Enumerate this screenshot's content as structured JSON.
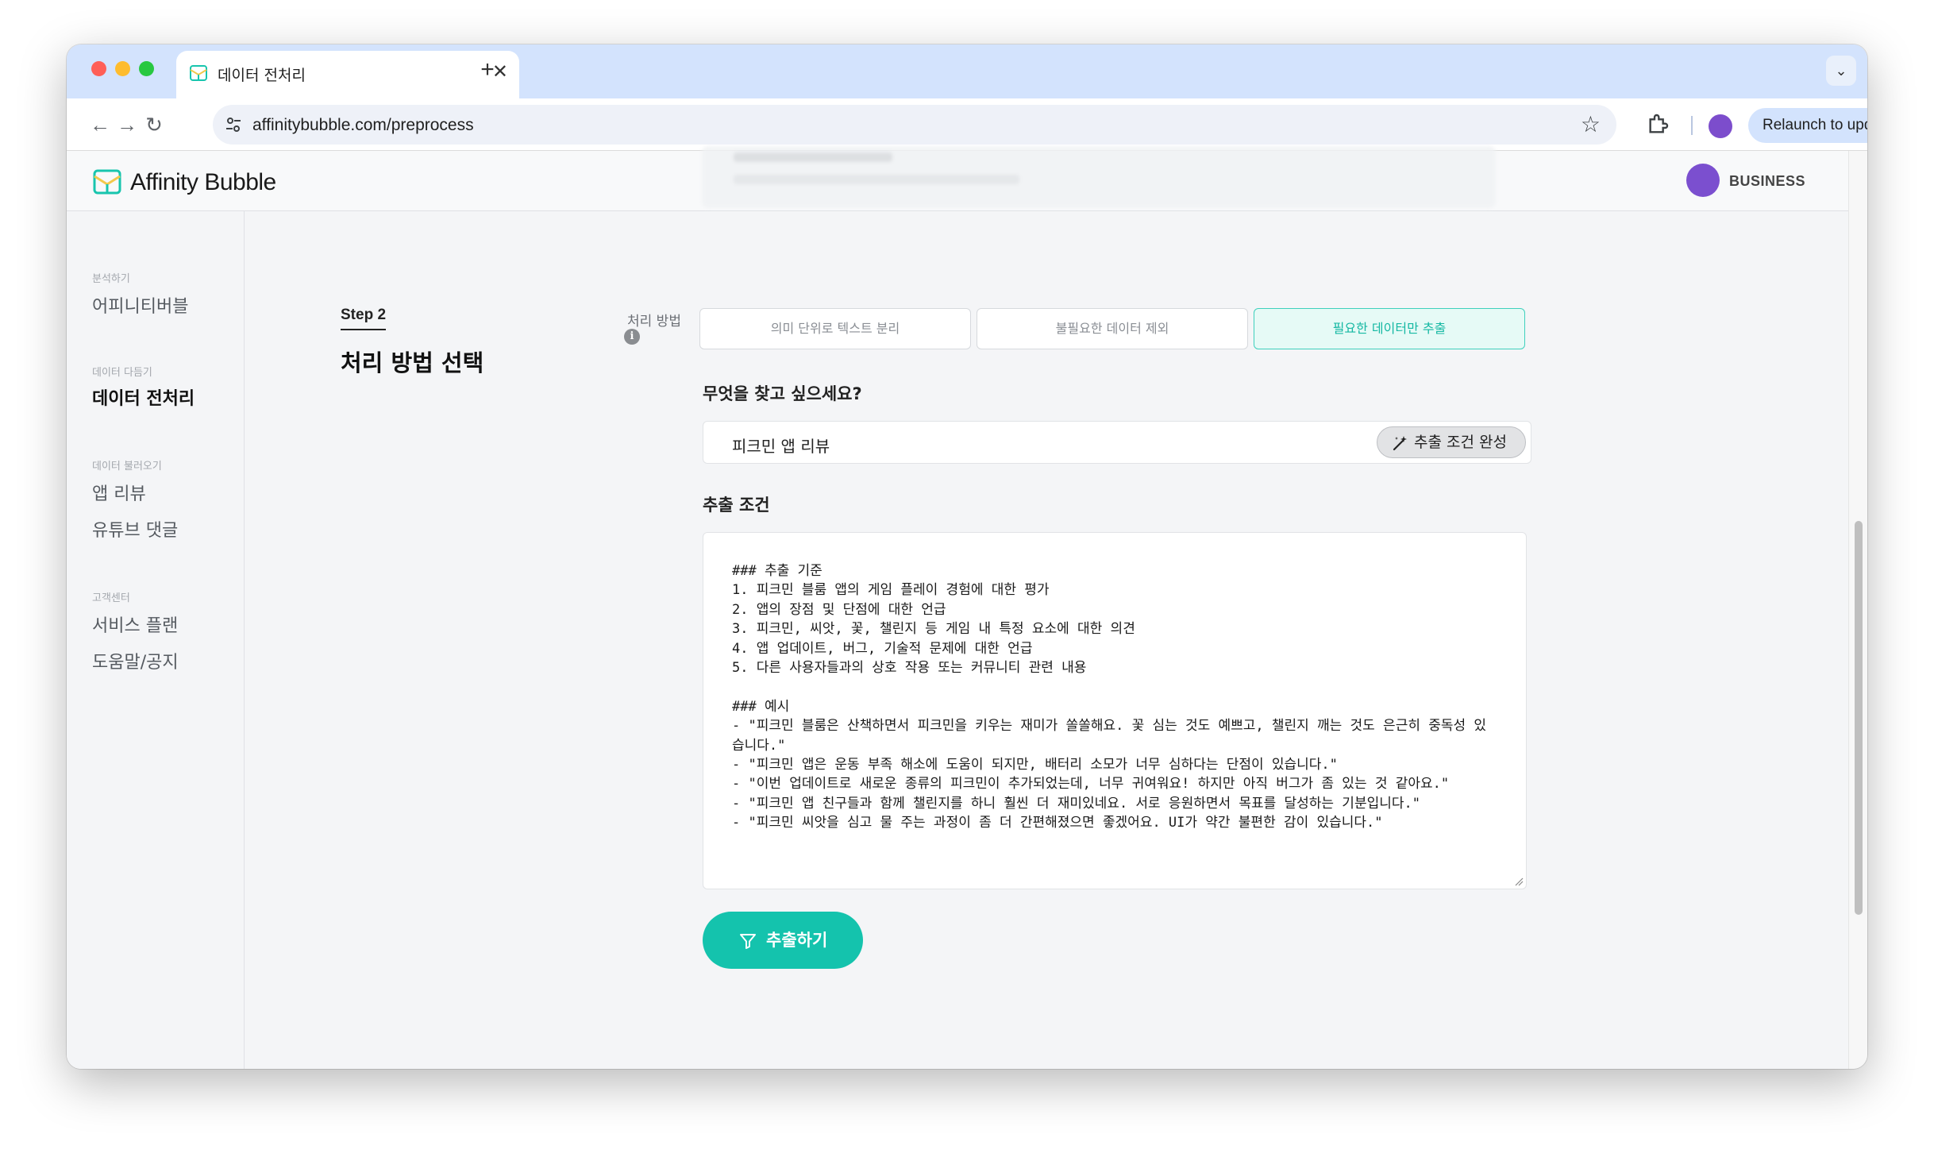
{
  "browser": {
    "tab_title": "데이터 전처리",
    "tab_close": "✕",
    "new_tab": "+",
    "url": "affinitybubble.com/preprocess",
    "relaunch_label": "Relaunch to update",
    "relaunch_more": "⋮"
  },
  "header": {
    "brand_name": "Affinity Bubble",
    "plan_label": "BUSINESS"
  },
  "sidebar": {
    "sections": [
      {
        "category": "분석하기",
        "items": [
          "어피니티버블"
        ]
      },
      {
        "category": "데이터 다듬기",
        "items": [
          "데이터 전처리"
        ]
      },
      {
        "category": "데이터 불러오기",
        "items": [
          "앱 리뷰",
          "유튜브 댓글"
        ]
      },
      {
        "category": "고객센터",
        "items": [
          "서비스 플랜",
          "도움말/공지"
        ]
      }
    ],
    "active_item": "데이터 전처리"
  },
  "main": {
    "step_label": "Step 2",
    "step_title": "처리 방법 선택",
    "method_label": "처리 방법",
    "info_glyph": "i",
    "methods": [
      "의미 단위로 텍스트 분리",
      "불필요한 데이터 제외",
      "필요한 데이터만 추출"
    ],
    "selected_method": "필요한 데이터만 추출",
    "question_label": "무엇을 찾고 싶으세요?",
    "query_value": "피크민 앱 리뷰",
    "complete_button": "추출 조건 완성",
    "conditions_label": "추출 조건",
    "conditions_text": "### 추출 기준\n1. 피크민 블룸 앱의 게임 플레이 경험에 대한 평가\n2. 앱의 장점 및 단점에 대한 언급\n3. 피크민, 씨앗, 꽃, 챌린지 등 게임 내 특정 요소에 대한 의견\n4. 앱 업데이트, 버그, 기술적 문제에 대한 언급\n5. 다른 사용자들과의 상호 작용 또는 커뮤니티 관련 내용\n\n### 예시\n- \"피크민 블룸은 산책하면서 피크민을 키우는 재미가 쏠쏠해요. 꽃 심는 것도 예쁘고, 챌린지 깨는 것도 은근히 중독성 있습니다.\"\n- \"피크민 앱은 운동 부족 해소에 도움이 되지만, 배터리 소모가 너무 심하다는 단점이 있습니다.\"\n- \"이번 업데이트로 새로운 종류의 피크민이 추가되었는데, 너무 귀여워요! 하지만 아직 버그가 좀 있는 것 같아요.\"\n- \"피크민 앱 친구들과 함께 챌린지를 하니 훨씬 더 재미있네요. 서로 응원하면서 목표를 달성하는 기분입니다.\"\n- \"피크민 씨앗을 심고 물 주는 과정이 좀 더 간편해졌으면 좋겠어요. UI가 약간 불편한 감이 있습니다.\"",
    "extract_button": "추출하기"
  },
  "colors": {
    "accent": "#14c3ad",
    "selected_bg": "#e6faf6",
    "tab_strip": "#d3e3fd",
    "avatar": "#7b4fcf"
  }
}
